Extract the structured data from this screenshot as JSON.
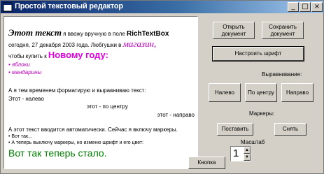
{
  "window": {
    "title": "Простой текстовый редактор"
  },
  "editor": {
    "l1a": "Этот текст",
    "l1b": " я ввожу вручную в поле ",
    "l1c": "RichTextBox",
    "l2a": "сегодня, 27 декабря 2003 года.",
    "l2b": "   Любгушки в ",
    "l2c": "магазин,",
    "l3a": "чтобы купить к ",
    "l3b": "Новому году:",
    "b1": "• яблоки",
    "b2": "• мандарины",
    "l4": "А я тем временем форматирую и выравниваю текст:",
    "left": "Этот - налево",
    "center": "этот - по центру",
    "right": "этот - направо",
    "l5": "А этот текст вводится автоматически. Сейчас я включу маркеры.",
    "b3": "• Вот так...",
    "b4": "• А теперь выключу маркеры, но изменю шрифт и его цвет:",
    "big": "Вот так теперь стало."
  },
  "buttons": {
    "open": "Открыть документ",
    "save": "Сохранить документ",
    "font": "Настроить шрифт",
    "left": "Налево",
    "center": "По центру",
    "right": "Направо",
    "place": "Поставить",
    "remove": "Снять",
    "knopka": "Кнопка"
  },
  "labels": {
    "align": "Выравнивание:",
    "markers": "Маркеры:",
    "scale": "Масштаб"
  },
  "scale": {
    "value": "1"
  }
}
